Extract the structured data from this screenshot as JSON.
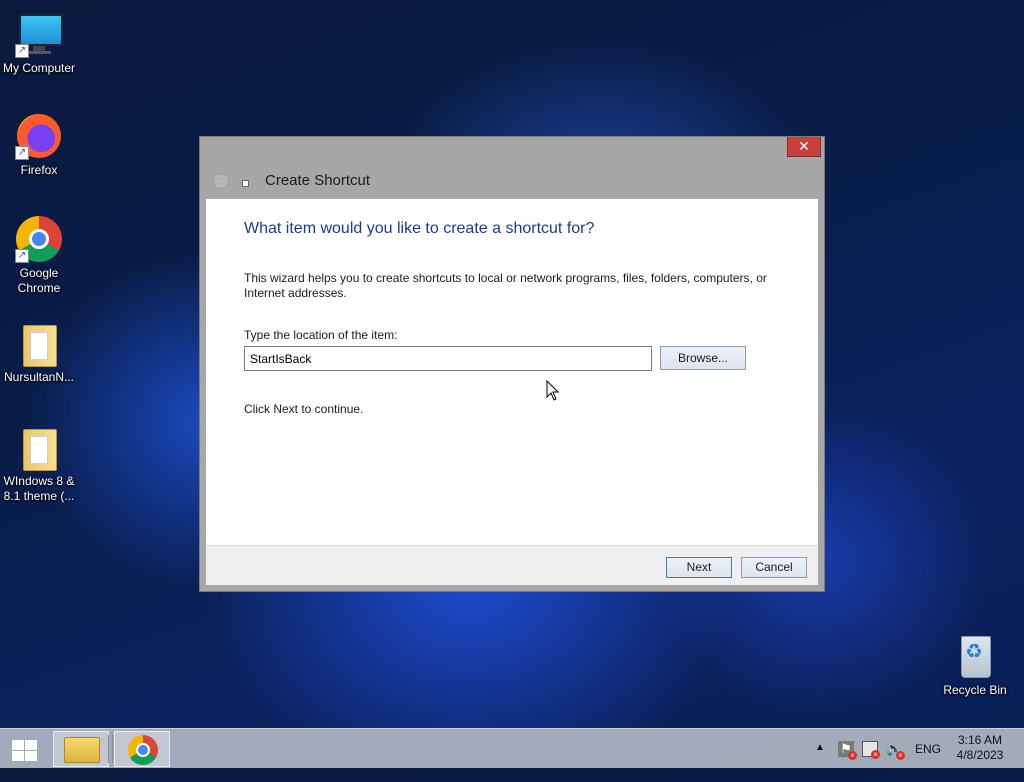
{
  "desktop": {
    "icons": [
      {
        "label": "My Computer"
      },
      {
        "label": "Firefox"
      },
      {
        "label": "Google Chrome"
      },
      {
        "label": "NursultanN..."
      },
      {
        "label": "WIndows 8 & 8.1 theme (..."
      },
      {
        "label": "Recycle Bin"
      }
    ]
  },
  "dialog": {
    "title": "Create Shortcut",
    "close_glyph": "✕",
    "heading": "What item would you like to create a shortcut for?",
    "description": "This wizard helps you to create shortcuts to local or network programs, files, folders, computers, or Internet addresses.",
    "location_label": "Type the location of the item:",
    "location_value": "StartIsBack",
    "browse_label": "Browse...",
    "hint": "Click Next to continue.",
    "next_label": "Next",
    "cancel_label": "Cancel"
  },
  "taskbar": {
    "tray_chevron": "▲",
    "language": "ENG",
    "time": "3:16 AM",
    "date": "4/8/2023"
  }
}
